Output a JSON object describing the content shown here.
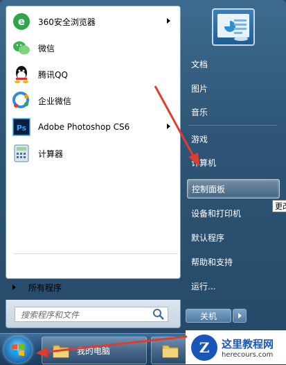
{
  "programs": [
    {
      "label": "360安全浏览器",
      "icon": "360-browser-icon",
      "submenu": true
    },
    {
      "label": "微信",
      "icon": "wechat-icon",
      "submenu": false
    },
    {
      "label": "腾讯QQ",
      "icon": "qq-icon",
      "submenu": false
    },
    {
      "label": "企业微信",
      "icon": "wecom-icon",
      "submenu": false
    },
    {
      "label": "Adobe Photoshop CS6",
      "icon": "photoshop-icon",
      "submenu": true
    },
    {
      "label": "计算器",
      "icon": "calculator-icon",
      "submenu": false
    }
  ],
  "all_programs_label": "所有程序",
  "search": {
    "placeholder": "搜索程序和文件"
  },
  "right_menu": [
    {
      "label": "文档"
    },
    {
      "label": "图片"
    },
    {
      "label": "音乐"
    },
    {
      "label": "游戏"
    },
    {
      "label": "计算机"
    },
    {
      "label": "控制面板",
      "active": true
    },
    {
      "label": "设备和打印机"
    },
    {
      "label": "默认程序"
    },
    {
      "label": "帮助和支持"
    },
    {
      "label": "运行..."
    }
  ],
  "shutdown_label": "关机",
  "tooltip": "更改",
  "taskbar": {
    "items": [
      {
        "label": "我的电脑"
      },
      {
        "label": ""
      }
    ]
  },
  "watermark": {
    "title": "这里教程网",
    "url": "herecours.com"
  },
  "colors": {
    "accent_arrow": "#e23b2e",
    "frame": "#2e5575"
  }
}
